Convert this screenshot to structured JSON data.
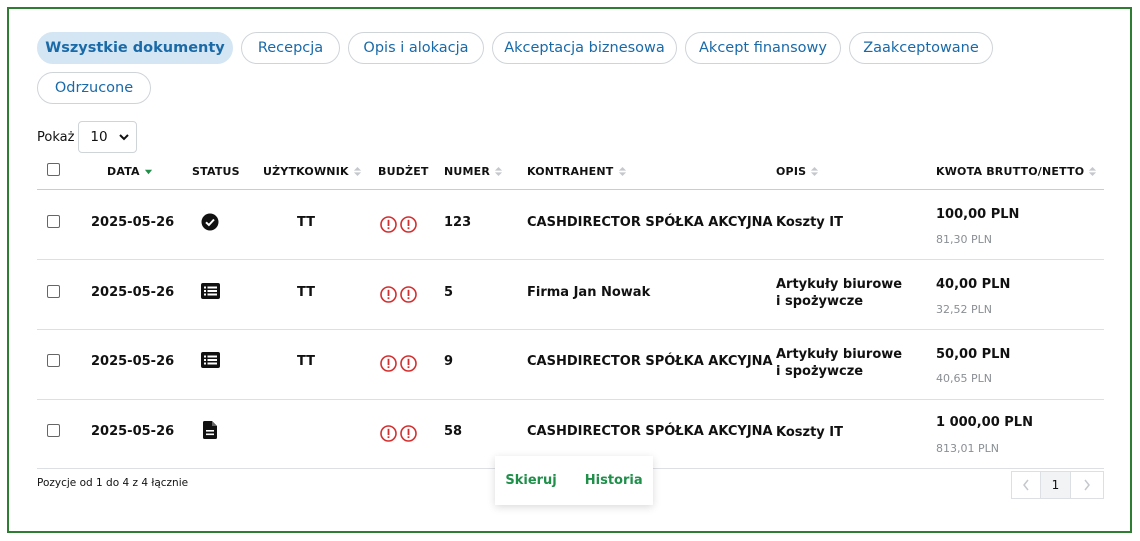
{
  "tabs": [
    {
      "label": "Wszystkie dokumenty",
      "active": true
    },
    {
      "label": "Recepcja"
    },
    {
      "label": "Opis i alokacja"
    },
    {
      "label": "Akceptacja biznesowa"
    },
    {
      "label": "Akcept finansowy"
    },
    {
      "label": "Zaakceptowane"
    },
    {
      "label": "Odrzucone"
    }
  ],
  "page_size": {
    "label": "Pokaż",
    "value": "10"
  },
  "columns": {
    "date": "DATA",
    "status": "STATUS",
    "user": "UŻYTKOWNIK",
    "budget": "BUDŻET",
    "number": "NUMER",
    "contractor": "KONTRAHENT",
    "description": "OPIS",
    "amount": "KWOTA BRUTTO/NETTO"
  },
  "rows": [
    {
      "date": "2025-05-26",
      "status_icon": "check-circle-icon",
      "user": "TT",
      "number": "123",
      "contractor": "CASHDIRECTOR SPÓŁKA AKCYJNA",
      "description": "Koszty IT",
      "gross": "100,00  PLN",
      "net": "81,30 PLN"
    },
    {
      "date": "2025-05-26",
      "status_icon": "list-icon",
      "user": "TT",
      "number": "5",
      "contractor": "Firma Jan Nowak",
      "description": "Artykuły biurowe i spożywcze",
      "gross": "40,00  PLN",
      "net": "32,52 PLN"
    },
    {
      "date": "2025-05-26",
      "status_icon": "list-icon",
      "user": "TT",
      "number": "9",
      "contractor": "CASHDIRECTOR SPÓŁKA AKCYJNA",
      "description": "Artykuły biurowe i spożywcze",
      "gross": "50,00  PLN",
      "net": "40,65 PLN"
    },
    {
      "date": "2025-05-26",
      "status_icon": "document-icon",
      "user": "",
      "number": "58",
      "contractor": "CASHDIRECTOR SPÓŁKA AKCYJNA",
      "description": "Koszty IT",
      "gross": "1 000,00  PLN",
      "net": "813,01 PLN"
    }
  ],
  "footer": {
    "info": "Pozycje od 1 do 4 z 4 łącznie",
    "current_page": "1"
  },
  "popup": {
    "direct": "Skieruj",
    "history": "Historia"
  },
  "colors": {
    "accent_blue": "#1a6aa8",
    "accent_green": "#1f8f4a",
    "frame": "#2e7d32",
    "warning_red": "#d32f2f"
  }
}
